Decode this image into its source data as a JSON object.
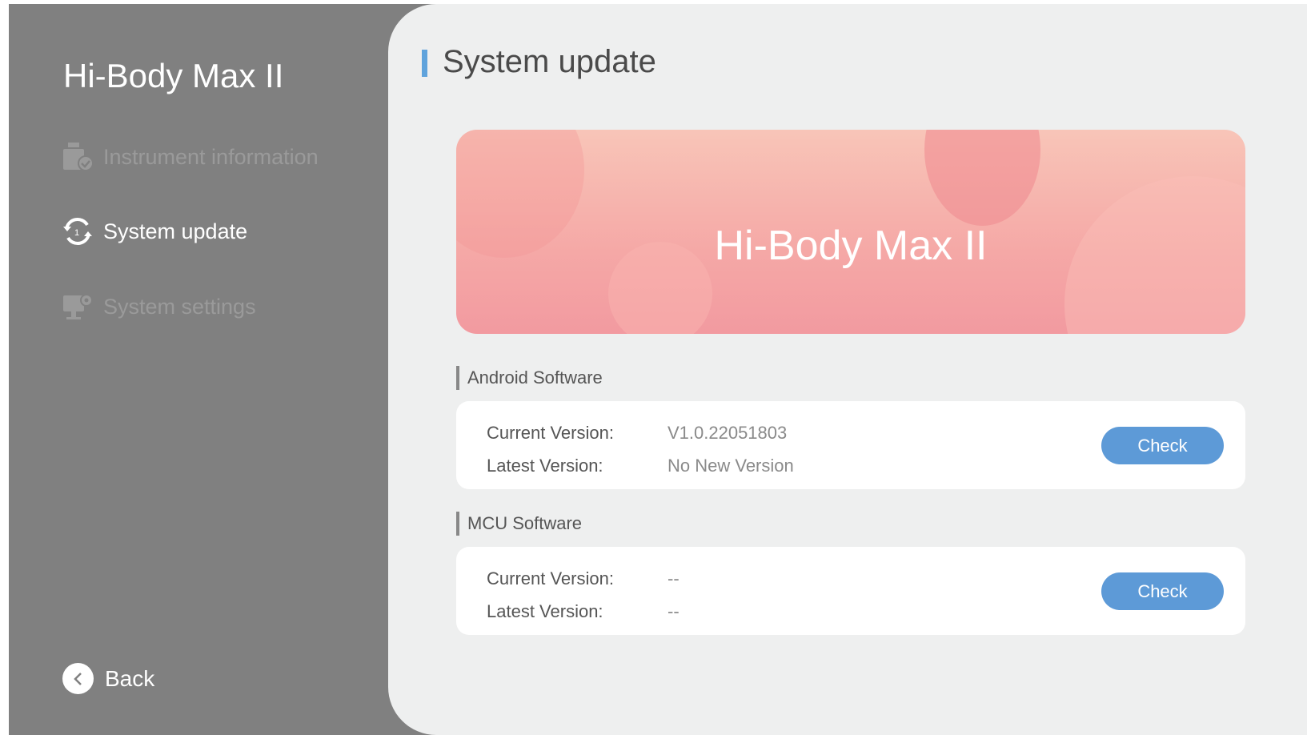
{
  "sidebar": {
    "app_title": "Hi-Body Max II",
    "items": [
      {
        "label": "Instrument information",
        "icon": "instrument-info-icon",
        "state": "inactive"
      },
      {
        "label": "System update",
        "icon": "system-update-icon",
        "state": "active"
      },
      {
        "label": "System settings",
        "icon": "system-settings-icon",
        "state": "inactive"
      }
    ],
    "back_label": "Back"
  },
  "main": {
    "page_title": "System update",
    "banner_title": "Hi-Body Max II",
    "sections": [
      {
        "title": "Android Software",
        "current_label": "Current Version:",
        "current_value": "V1.0.22051803",
        "latest_label": "Latest Version:",
        "latest_value": "No New Version",
        "button_label": "Check"
      },
      {
        "title": "MCU Software",
        "current_label": "Current Version:",
        "current_value": "--",
        "latest_label": "Latest Version:",
        "latest_value": "--",
        "button_label": "Check"
      }
    ]
  },
  "colors": {
    "sidebar_bg": "#808080",
    "main_bg": "#eeefef",
    "accent": "#5fa3dc",
    "button": "#5d9ad7",
    "banner_start": "#f8c5b8",
    "banner_end": "#f29aa0"
  }
}
